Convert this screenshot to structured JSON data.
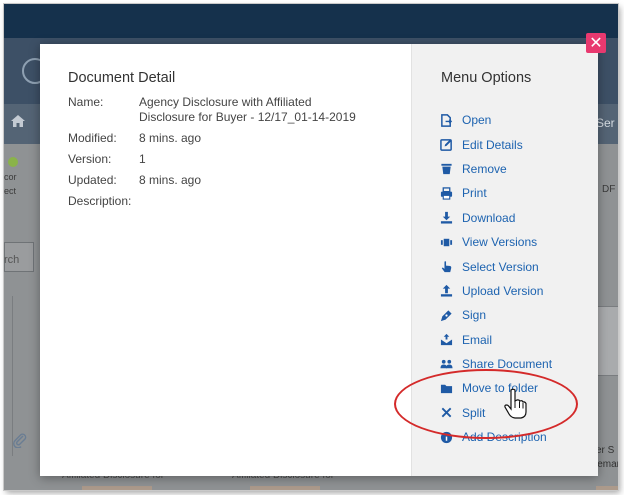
{
  "background": {
    "nav_partial_text": "Ser",
    "left_partial_texts": [
      "cor",
      "ect",
      "rch"
    ],
    "right_partial_pdf": "DF",
    "right_partial_s": "er S",
    "right_partial_demand": "Demand",
    "bottom_items": [
      "Affiliated Disclosure for",
      "Affiliated Disclosure for"
    ]
  },
  "modal": {
    "close_icon": "close-icon",
    "document_detail": {
      "title": "Document Detail",
      "fields": [
        {
          "label": "Name:",
          "value": "Agency Disclosure with Affiliated Disclosure for Buyer - 12/17_01-14-2019"
        },
        {
          "label": "Modified:",
          "value": "8 mins. ago"
        },
        {
          "label": "Version:",
          "value": "1"
        },
        {
          "label": "Updated:",
          "value": "8 mins. ago"
        },
        {
          "label": "Description:",
          "value": ""
        }
      ]
    },
    "menu": {
      "title": "Menu Options",
      "items": [
        {
          "label": "Open",
          "icon": "open-icon"
        },
        {
          "label": "Edit Details",
          "icon": "edit-icon"
        },
        {
          "label": "Remove",
          "icon": "trash-icon"
        },
        {
          "label": "Print",
          "icon": "print-icon"
        },
        {
          "label": "Download",
          "icon": "download-icon"
        },
        {
          "label": "View Versions",
          "icon": "versions-icon"
        },
        {
          "label": "Select Version",
          "icon": "hand-pointer-icon"
        },
        {
          "label": "Upload Version",
          "icon": "upload-icon"
        },
        {
          "label": "Sign",
          "icon": "pen-icon"
        },
        {
          "label": "Email",
          "icon": "email-icon"
        },
        {
          "label": "Share Document",
          "icon": "share-users-icon"
        },
        {
          "label": "Move to folder",
          "icon": "folder-icon"
        },
        {
          "label": "Split",
          "icon": "split-x-icon"
        },
        {
          "label": "Add Description",
          "icon": "info-circle-icon"
        }
      ]
    }
  },
  "colors": {
    "link": "#1d63b0",
    "close_button": "#e8396f",
    "annotation_circle": "#d42a2a"
  }
}
